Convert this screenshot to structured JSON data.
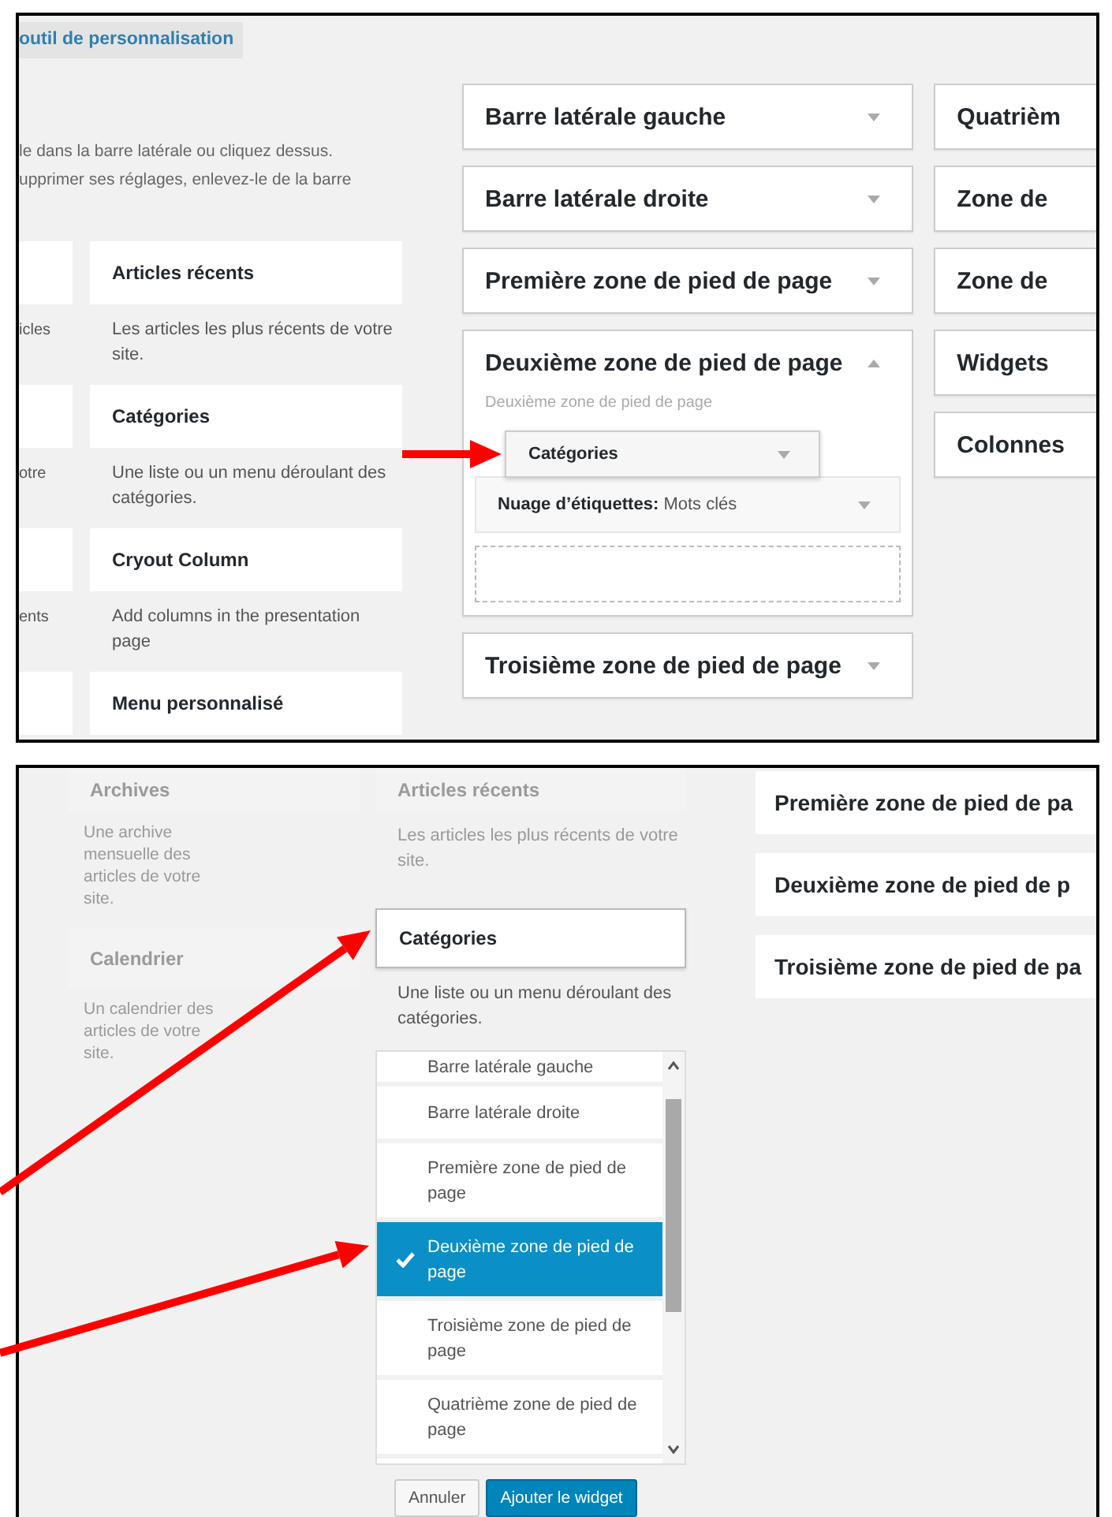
{
  "top_panel": {
    "customizer_tab": "outil de personnalisation",
    "intro": [
      "le dans la barre latérale ou cliquez dessus.",
      "upprimer ses réglages, enlevez-le de la barre"
    ],
    "widgets": [
      {
        "title": "Articles récents",
        "description": "Les articles les plus récents de votre site.",
        "cut_description": "icles"
      },
      {
        "title": "Catégories",
        "description": "Une liste ou un menu déroulant des catégories.",
        "cut_description": "otre"
      },
      {
        "title": "Cryout Column",
        "description": "Add columns in the presentation page",
        "cut_description": "ents"
      },
      {
        "title": "Menu personnalisé"
      }
    ],
    "sidebars": [
      {
        "title": "Barre latérale gauche",
        "expanded": false
      },
      {
        "title": "Barre latérale droite",
        "expanded": false
      },
      {
        "title": "Première zone de pied de page",
        "expanded": false
      },
      {
        "title": "Deuxième zone de pied de page",
        "expanded": true,
        "description": "Deuxième zone de pied de page",
        "widgets": [
          {
            "title": "Nuage d’étiquettes:",
            "subtitle": "Mots clés"
          }
        ]
      },
      {
        "title": "Troisième zone de pied de page",
        "expanded": false
      }
    ],
    "sidebars_column_2": [
      "Quatrièm",
      "Zone de",
      "Zone de",
      "Widgets",
      "Colonnes"
    ],
    "dragged_widget": "Catégories"
  },
  "bottom_panel": {
    "widgets": [
      {
        "title": "Archives",
        "description": "Une archive mensuelle des articles de votre site.",
        "disabled": true
      },
      {
        "title": "Calendrier",
        "description": "Un calendrier des articles de votre site.",
        "disabled": true
      },
      {
        "title": "Articles récents",
        "description": "Les articles les plus récents de votre site.",
        "disabled": true
      },
      {
        "title": "Catégories",
        "description": "Une liste ou un menu déroulant des catégories.",
        "disabled": false
      }
    ],
    "sidebar_choices": [
      {
        "label": "Barre latérale gauche",
        "selected": false
      },
      {
        "label": "Barre latérale droite",
        "selected": false
      },
      {
        "label": "Première zone de pied de page",
        "selected": false
      },
      {
        "label": "Deuxième zone de pied de page",
        "selected": true
      },
      {
        "label": "Troisième zone de pied de page",
        "selected": false
      },
      {
        "label": "Quatrième zone de pied de page",
        "selected": false
      }
    ],
    "buttons": [
      {
        "label": "Annuler",
        "kind": "secondary"
      },
      {
        "label": "Ajouter le widget",
        "kind": "primary"
      }
    ],
    "sidebars": [
      "Première zone de pied de pa",
      "Deuxième zone de pied de p",
      "Troisième zone de pied de pa"
    ]
  }
}
